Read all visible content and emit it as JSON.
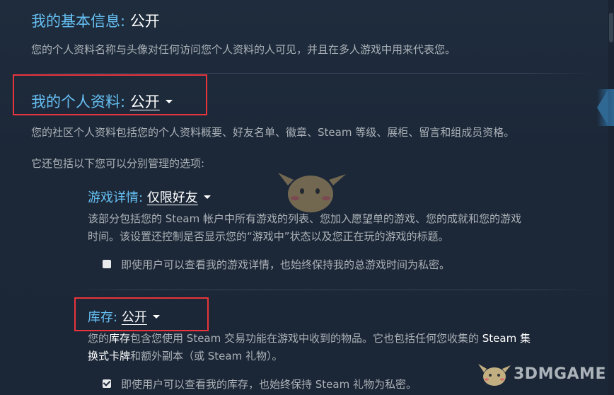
{
  "basic_info": {
    "label": "我的基本信息:",
    "value": "公开",
    "description": "您的个人资料名称与头像对任何访问您个人资料的人可见，并且在多人游戏中用来代表您。"
  },
  "profile": {
    "label": "我的个人资料:",
    "value": "公开",
    "description": "您的社区个人资料包括您的个人资料概要、好友名单、徽章、Steam 等级、展柜、留言和组成员资格。",
    "note": "它还包括以下您可以分别管理的选项:"
  },
  "game_details": {
    "label": "游戏详情:",
    "value": "仅限好友",
    "description_line1": "该部分包括您的 Steam 帐户中所有游戏的列表、您加入愿望单的游戏、您的成就和您的游戏",
    "description_line2": "时间。该设置还控制是否显示您的“游戏中”状态以及您正在玩的游戏的标题。",
    "checkbox_label": "即使用户可以查看我的游戏详情，也始终保持我的总游戏时间为私密。",
    "checkbox_checked": false
  },
  "inventory": {
    "label": "库存:",
    "value": "公开",
    "desc_part1": "您的",
    "desc_bold1": "库存",
    "desc_part2": "包含您使用 Steam 交易功能在游戏中收到的物品。它也包括任何您收集的 ",
    "desc_bold2": "Steam 集",
    "desc_bold3": "换式卡牌",
    "desc_part3": "和额外副本（或 Steam 礼物）。",
    "checkbox_label": "即使用户可以查看我的库存，也始终保持 Steam 礼物为私密。",
    "checkbox_checked": true
  },
  "watermark": {
    "text": "3DMGAME"
  },
  "colors": {
    "background": "#1b2636",
    "label_blue": "#66c0f4",
    "body_text": "#acb2b8",
    "highlight_red": "#e8353b"
  }
}
